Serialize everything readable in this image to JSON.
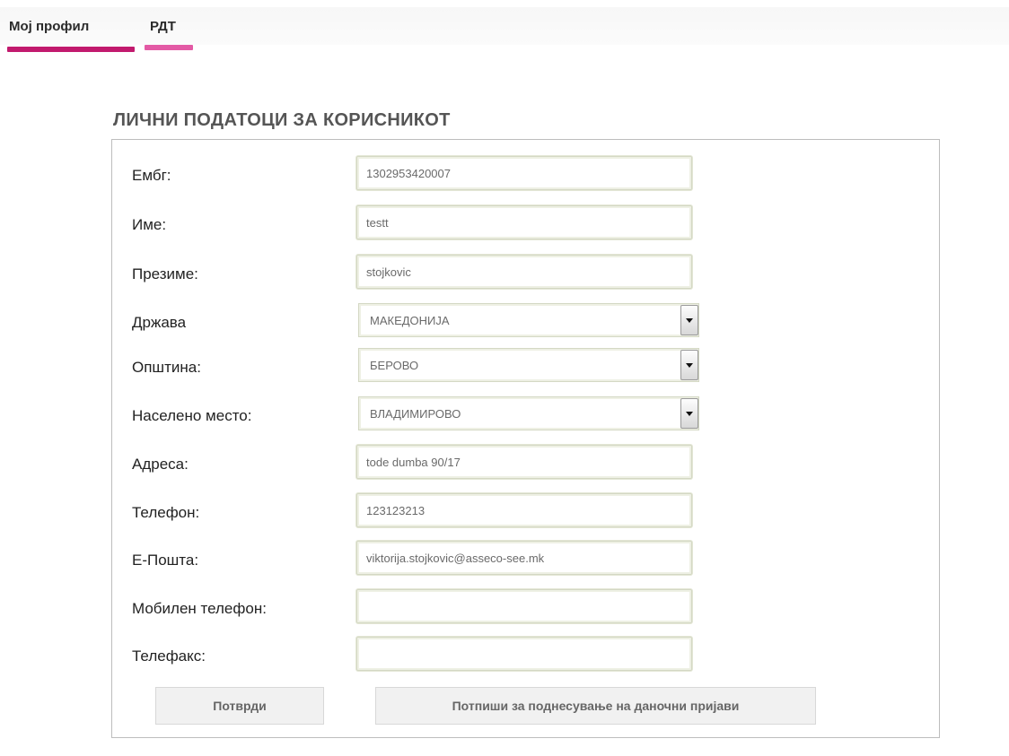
{
  "tabs": [
    {
      "label": "Мој профил",
      "color": "#c21a6e"
    },
    {
      "label": "РДТ",
      "color": "#e35aa5"
    }
  ],
  "page": {
    "title": "ЛИЧНИ ПОДАТОЦИ ЗА КОРИСНИКОТ"
  },
  "form": {
    "embg": {
      "label": "Ембг:",
      "value": "1302953420007"
    },
    "ime": {
      "label": "Име:",
      "value": "testt"
    },
    "prezime": {
      "label": "Презиме:",
      "value": "stojkovic"
    },
    "drzava": {
      "label": "Држава",
      "value": "МАКЕДОНИЈА"
    },
    "opstina": {
      "label": "Општина:",
      "value": "БЕРОВО"
    },
    "naseleno": {
      "label": "Населено место:",
      "value": "ВЛАДИМИРОВО"
    },
    "adresa": {
      "label": "Адреса:",
      "value": "tode dumba 90/17"
    },
    "telefon": {
      "label": "Телефон:",
      "value": "123123213"
    },
    "eposta": {
      "label": "Е-Пошта:",
      "value": "viktorija.stojkovic@asseco-see.mk"
    },
    "mobilen": {
      "label": "Мобилен телефон:",
      "value": ""
    },
    "telefaks": {
      "label": "Телефакс:",
      "value": ""
    }
  },
  "buttons": {
    "confirm": "Потврди",
    "sign": "Потпиши за поднесување на даночни пријави"
  }
}
